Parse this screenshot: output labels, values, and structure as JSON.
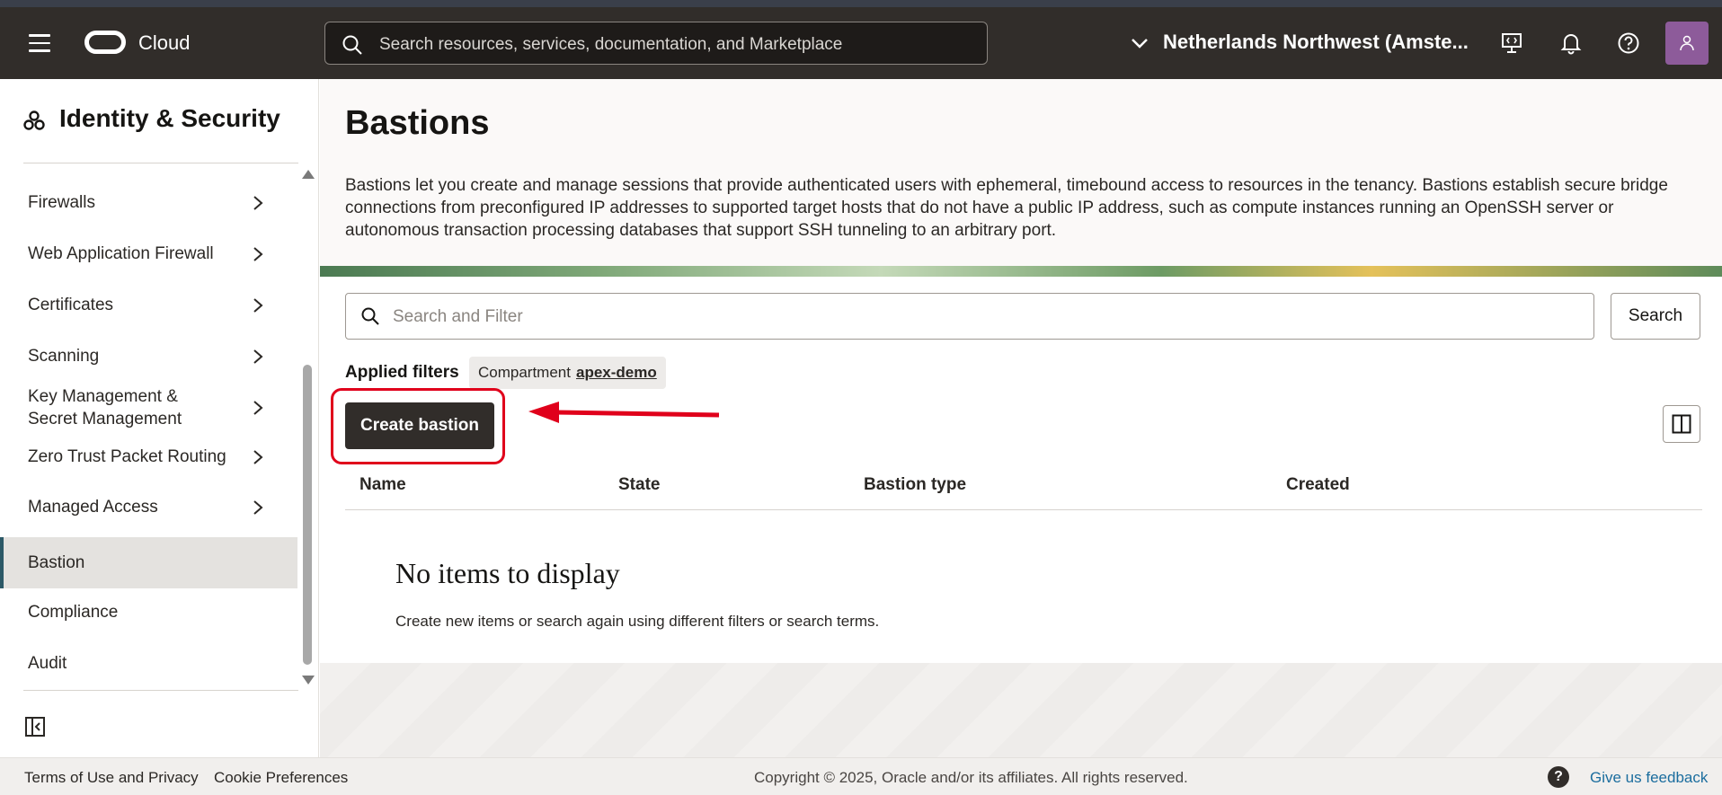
{
  "header": {
    "brand": "Cloud",
    "search_placeholder": "Search resources, services, documentation, and Marketplace",
    "region": "Netherlands Northwest (Amste...",
    "icons": [
      "menu-icon",
      "oracle-logo",
      "search-icon",
      "chevron-down-icon",
      "developer-tools-icon",
      "bell-icon",
      "help-icon",
      "user-avatar-icon"
    ]
  },
  "sidebar": {
    "title": "Identity & Security",
    "items": [
      {
        "label": "Firewalls",
        "has_submenu": true
      },
      {
        "label": "Web Application Firewall",
        "has_submenu": true
      },
      {
        "label": "Certificates",
        "has_submenu": true
      },
      {
        "label": "Scanning",
        "has_submenu": true
      },
      {
        "label": "Key Management &\nSecret Management",
        "has_submenu": true
      },
      {
        "label": "Zero Trust Packet Routing",
        "has_submenu": true
      },
      {
        "label": "Managed Access",
        "has_submenu": true
      },
      {
        "label": "Bastion",
        "has_submenu": false,
        "active": true
      },
      {
        "label": "Compliance",
        "has_submenu": false
      },
      {
        "label": "Audit",
        "has_submenu": false
      }
    ]
  },
  "main": {
    "title": "Bastions",
    "description": "Bastions let you create and manage sessions that provide authenticated users with ephemeral, timebound access to resources in the tenancy. Bastions establish secure bridge connections from preconfigured IP addresses to supported target hosts that do not have a public IP address, such as compute instances running an OpenSSH server or autonomous transaction processing databases that support SSH tunneling to an arbitrary port.",
    "filter_placeholder": "Search and Filter",
    "search_button": "Search",
    "applied_filters_label": "Applied filters",
    "filter_chip": {
      "key": "Compartment",
      "value": "apex-demo"
    },
    "create_button": "Create bastion",
    "columns": [
      "Name",
      "State",
      "Bastion type",
      "Created"
    ],
    "empty_title": "No items to display",
    "empty_subtitle": "Create new items or search again using different filters or search terms."
  },
  "footer": {
    "terms": "Terms of Use and Privacy",
    "cookies": "Cookie Preferences",
    "copyright": "Copyright © 2025, Oracle and/or its affiliates. All rights reserved.",
    "help": "?",
    "feedback": "Give us feedback"
  },
  "colors": {
    "header_bg": "#312d2a",
    "active_accent": "#2c5967",
    "highlight_annotation": "#e0001b",
    "feedback_link": "#1b6d9e"
  }
}
